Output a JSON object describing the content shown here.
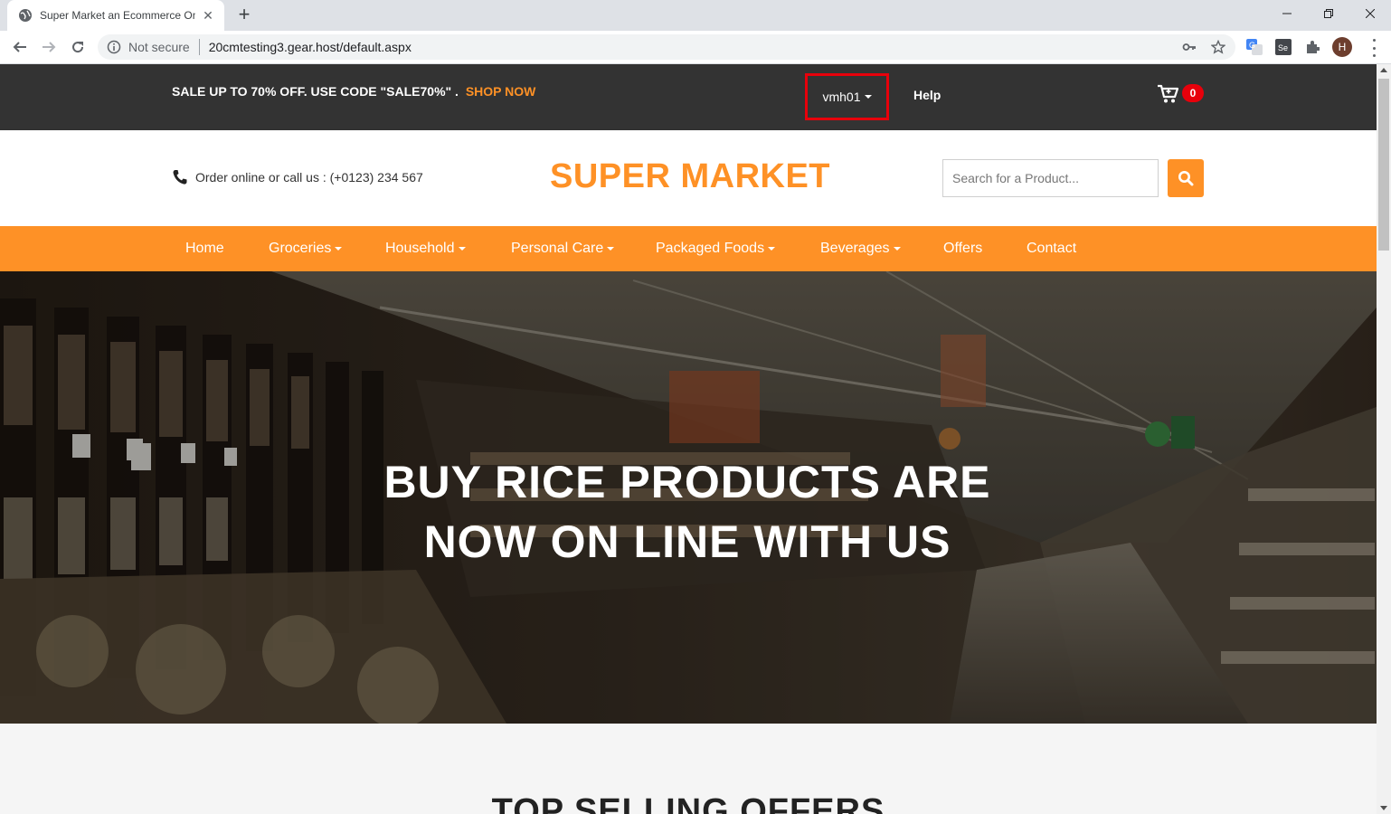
{
  "browser": {
    "tab_title": "Super Market an Ecommerce Onl",
    "new_tab": "+",
    "security_label": "Not secure",
    "url": "20cmtesting3.gear.host/default.aspx",
    "profile_initial": "H"
  },
  "topbar": {
    "promo_text": "SALE UP TO 70% OFF. USE CODE \"SALE70%\" .",
    "shop_now": "SHOP NOW",
    "user": "vmh01",
    "help": "Help",
    "cart_count": "0"
  },
  "header": {
    "phone_text": "Order online or call us : (+0123) 234 567",
    "brand": "SUPER MARKET",
    "search_placeholder": "Search for a Product..."
  },
  "nav": {
    "items": [
      "Home",
      "Groceries",
      "Household",
      "Personal Care",
      "Packaged Foods",
      "Beverages",
      "Offers",
      "Contact"
    ]
  },
  "hero": {
    "line1": "BUY RICE PRODUCTS ARE",
    "line2": "NOW ON LINE WITH US"
  },
  "section": {
    "title": "TOP SELLING OFFERS"
  },
  "colors": {
    "accent": "#fe9126",
    "topbar": "#333333",
    "badge": "#e8000b"
  }
}
